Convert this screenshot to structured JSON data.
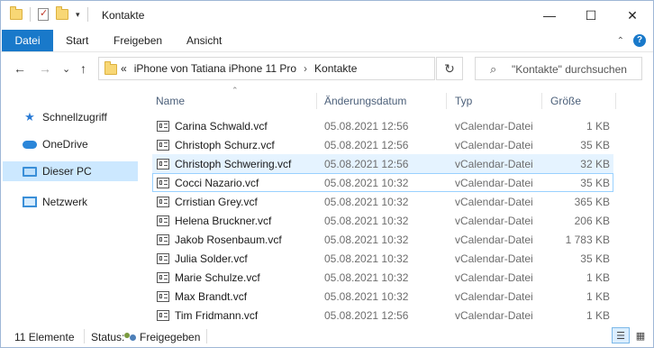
{
  "window": {
    "title": "Kontakte",
    "controls": {
      "minimize": "—",
      "maximize": "☐",
      "close": "✕"
    }
  },
  "quick_access": {
    "dropdown_glyph": "▾"
  },
  "ribbon": {
    "tabs": [
      "Datei",
      "Start",
      "Freigeben",
      "Ansicht"
    ],
    "collapse_glyph": "⌃",
    "help_glyph": "?"
  },
  "navigation": {
    "back_glyph": "←",
    "forward_glyph": "→",
    "recent_glyph": "⌄",
    "up_glyph": "↑",
    "refresh_glyph": "↻"
  },
  "address": {
    "overflow": "«",
    "crumbs": [
      "iPhone von Tatiana iPhone 11 Pro",
      "Kontakte"
    ],
    "separator": "›"
  },
  "search": {
    "placeholder": "\"Kontakte\" durchsuchen",
    "icon": "search-icon"
  },
  "sidebar": {
    "items": [
      {
        "label": "Schnellzugriff",
        "icon": "star-icon",
        "selected": false
      },
      {
        "label": "OneDrive",
        "icon": "cloud-icon",
        "selected": false
      },
      {
        "label": "Dieser PC",
        "icon": "computer-icon",
        "selected": true
      },
      {
        "label": "Netzwerk",
        "icon": "network-icon",
        "selected": false
      }
    ]
  },
  "columns": {
    "name": "Name",
    "date": "Änderungsdatum",
    "type": "Typ",
    "size": "Größe",
    "sort_glyph": "⌃"
  },
  "files": [
    {
      "name": "Carina Schwald.vcf",
      "date": "05.08.2021 12:56",
      "type": "vCalendar-Datei",
      "size": "1 KB",
      "state": ""
    },
    {
      "name": "Christoph Schurz.vcf",
      "date": "05.08.2021 12:56",
      "type": "vCalendar-Datei",
      "size": "35 KB",
      "state": ""
    },
    {
      "name": "Christoph Schwering.vcf",
      "date": "05.08.2021 12:56",
      "type": "vCalendar-Datei",
      "size": "32 KB",
      "state": "hover"
    },
    {
      "name": "Cocci Nazario.vcf",
      "date": "05.08.2021 10:32",
      "type": "vCalendar-Datei",
      "size": "35 KB",
      "state": "focus"
    },
    {
      "name": "Crristian Grey.vcf",
      "date": "05.08.2021 10:32",
      "type": "vCalendar-Datei",
      "size": "365 KB",
      "state": ""
    },
    {
      "name": "Helena Bruckner.vcf",
      "date": "05.08.2021 10:32",
      "type": "vCalendar-Datei",
      "size": "206 KB",
      "state": ""
    },
    {
      "name": "Jakob Rosenbaum.vcf",
      "date": "05.08.2021 10:32",
      "type": "vCalendar-Datei",
      "size": "1 783 KB",
      "state": ""
    },
    {
      "name": "Julia Solder.vcf",
      "date": "05.08.2021 10:32",
      "type": "vCalendar-Datei",
      "size": "35 KB",
      "state": ""
    },
    {
      "name": "Marie Schulze.vcf",
      "date": "05.08.2021 10:32",
      "type": "vCalendar-Datei",
      "size": "1 KB",
      "state": ""
    },
    {
      "name": "Max Brandt.vcf",
      "date": "05.08.2021 10:32",
      "type": "vCalendar-Datei",
      "size": "1 KB",
      "state": ""
    },
    {
      "name": "Tim Fridmann.vcf",
      "date": "05.08.2021 12:56",
      "type": "vCalendar-Datei",
      "size": "1 KB",
      "state": ""
    }
  ],
  "status": {
    "count": "11 Elemente",
    "status_label": "Status:",
    "shared": "Freigegeben",
    "view_details_glyph": "☰",
    "view_icons_glyph": "▦"
  },
  "colors": {
    "accent": "#1979ca",
    "selection": "#cce8ff",
    "hover": "#e5f3ff",
    "focus_border": "#99d1ff"
  }
}
